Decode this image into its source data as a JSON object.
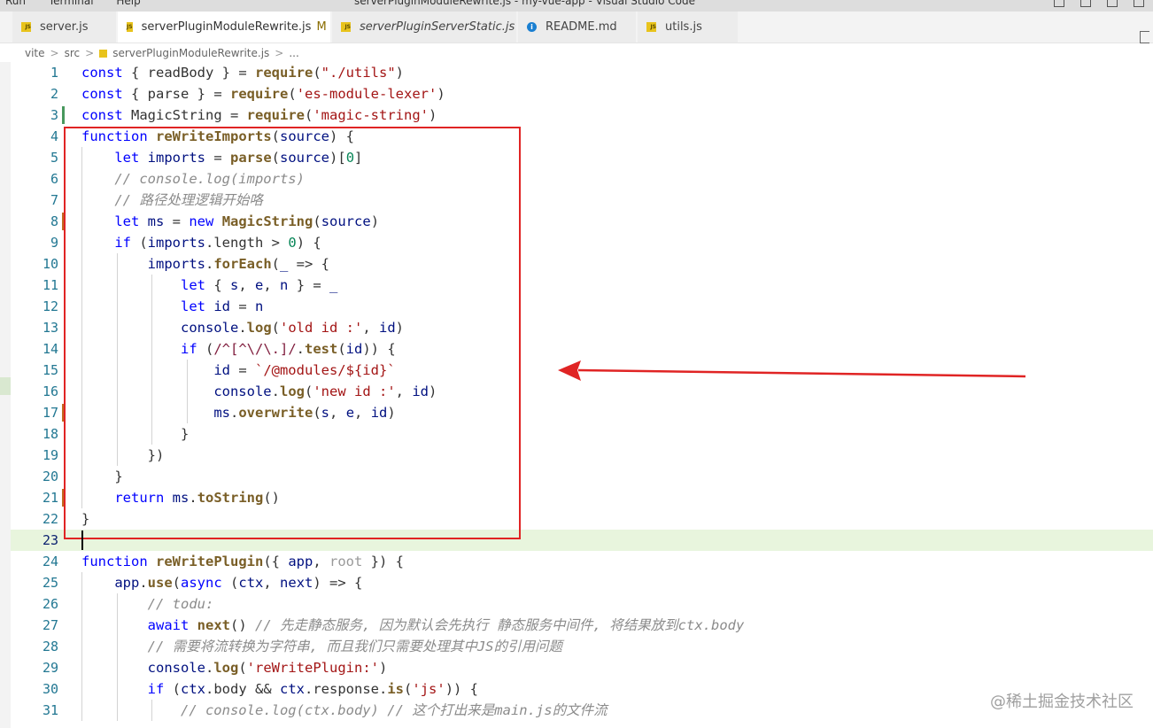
{
  "titlebar": {
    "menu": [
      "Run",
      "Terminal",
      "Help"
    ],
    "title": "serverPluginModuleRewrite.js - my-vue-app - Visual Studio Code"
  },
  "tabs": [
    {
      "label": "server.js",
      "icon": "js-icon",
      "active": false,
      "italic": false
    },
    {
      "label": "serverPluginModuleRewrite.js",
      "modified": "M",
      "icon": "js-icon",
      "active": true,
      "italic": false
    },
    {
      "label": "serverPluginServerStatic.js",
      "icon": "js-icon",
      "active": false,
      "italic": true
    },
    {
      "label": "README.md",
      "icon": "info-icon",
      "active": false,
      "italic": false
    },
    {
      "label": "utils.js",
      "icon": "js-icon",
      "active": false,
      "italic": false
    }
  ],
  "breadcrumb": {
    "parts": [
      "vite",
      "src",
      "serverPluginModuleRewrite.js",
      "..."
    ],
    "separator": ">"
  },
  "editor": {
    "current_line": 23,
    "lines": [
      {
        "n": "1",
        "text": "const { readBody } = require(\"./utils\")"
      },
      {
        "n": "2",
        "text": "const { parse } = require('es-module-lexer')"
      },
      {
        "n": "3",
        "text": "const MagicString = require('magic-string')"
      },
      {
        "n": "4",
        "text": "function reWriteImports(source) {"
      },
      {
        "n": "5",
        "text": "    let imports = parse(source)[0]"
      },
      {
        "n": "6",
        "text": "    // console.log(imports)"
      },
      {
        "n": "7",
        "text": "    // 路径处理逻辑开始咯"
      },
      {
        "n": "8",
        "text": "    let ms = new MagicString(source)"
      },
      {
        "n": "9",
        "text": "    if (imports.length > 0) {"
      },
      {
        "n": "10",
        "text": "        imports.forEach(_ => {"
      },
      {
        "n": "11",
        "text": "            let { s, e, n } = _"
      },
      {
        "n": "12",
        "text": "            let id = n"
      },
      {
        "n": "13",
        "text": "            console.log('old id :', id)"
      },
      {
        "n": "14",
        "text": "            if (/^[^\\/\\.]/.test(id)) {"
      },
      {
        "n": "15",
        "text": "                id = `/@modules/${id}`"
      },
      {
        "n": "16",
        "text": "                console.log('new id :', id)"
      },
      {
        "n": "17",
        "text": "                ms.overwrite(s, e, id)"
      },
      {
        "n": "18",
        "text": "            }"
      },
      {
        "n": "19",
        "text": "        })"
      },
      {
        "n": "20",
        "text": "    }"
      },
      {
        "n": "21",
        "text": "    return ms.toString()"
      },
      {
        "n": "22",
        "text": "}"
      },
      {
        "n": "23",
        "text": ""
      },
      {
        "n": "24",
        "text": "function reWritePlugin({ app, root }) {"
      },
      {
        "n": "25",
        "text": "    app.use(async (ctx, next) => {"
      },
      {
        "n": "26",
        "text": "        // todu:"
      },
      {
        "n": "27",
        "text": "        await next() // 先走静态服务, 因为默认会先执行 静态服务中间件, 将结果放到ctx.body"
      },
      {
        "n": "28",
        "text": "        // 需要将流转换为字符串, 而且我们只需要处理其中JS的引用问题"
      },
      {
        "n": "29",
        "text": "        console.log('reWritePlugin:')"
      },
      {
        "n": "30",
        "text": "        if (ctx.body && ctx.response.is('js')) {"
      },
      {
        "n": "31",
        "text": "            // console.log(ctx.body) // 这个打出来是main.js的文件流"
      }
    ]
  },
  "watermark": "@稀土掘金技术社区",
  "colors": {
    "keyword": "#0000ff",
    "function": "#795e26",
    "string": "#a31515",
    "comment": "#8b8b8b",
    "annotation": "#e02424",
    "line_number": "#237893"
  }
}
